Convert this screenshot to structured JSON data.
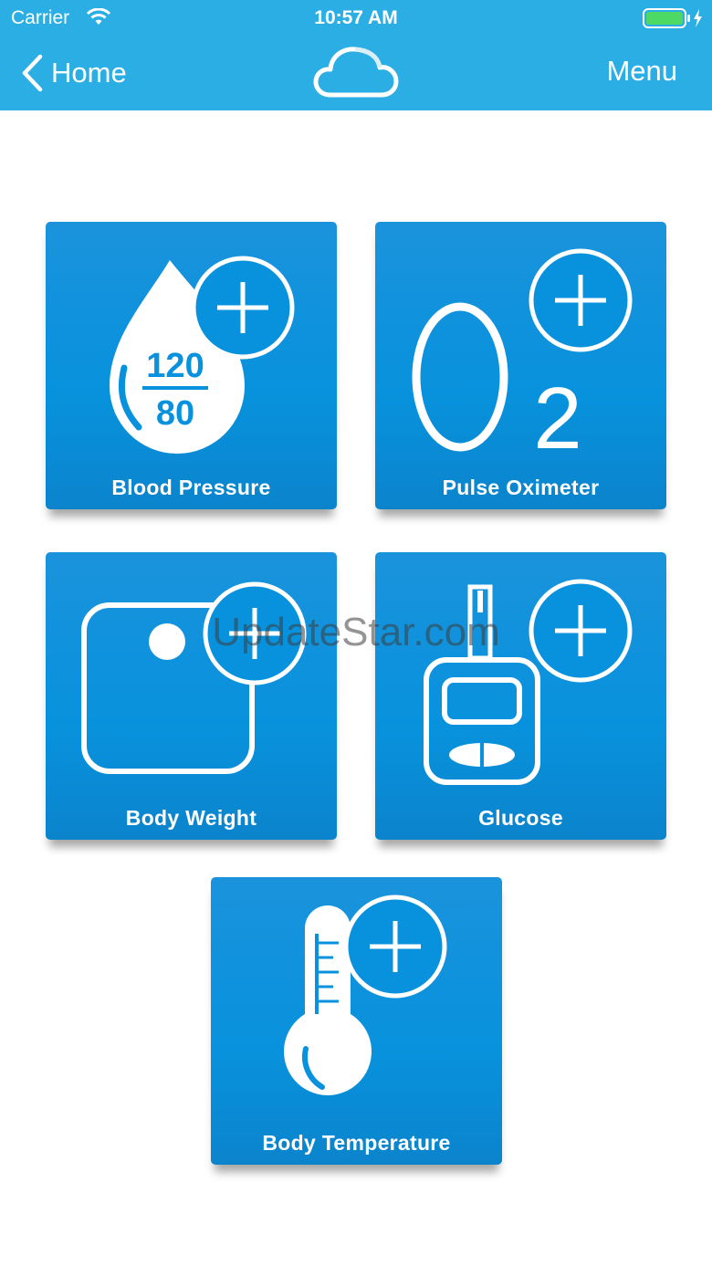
{
  "status_bar": {
    "carrier": "Carrier",
    "time": "10:57 AM"
  },
  "nav": {
    "back_label": "Home",
    "menu_label": "Menu"
  },
  "tiles": [
    {
      "label": "Blood Pressure",
      "icon": "blood-pressure-icon",
      "systolic": "120",
      "diastolic": "80"
    },
    {
      "label": "Pulse Oximeter",
      "icon": "o2-icon",
      "o_letter": "O",
      "subscript": "2"
    },
    {
      "label": "Body Weight",
      "icon": "scale-icon"
    },
    {
      "label": "Glucose",
      "icon": "glucose-meter-icon"
    },
    {
      "label": "Body Temperature",
      "icon": "thermometer-icon"
    }
  ],
  "watermark": "UpdateStar.com",
  "colors": {
    "header": "#2aaee4",
    "tile": "#0892dd",
    "battery": "#4cd964"
  }
}
